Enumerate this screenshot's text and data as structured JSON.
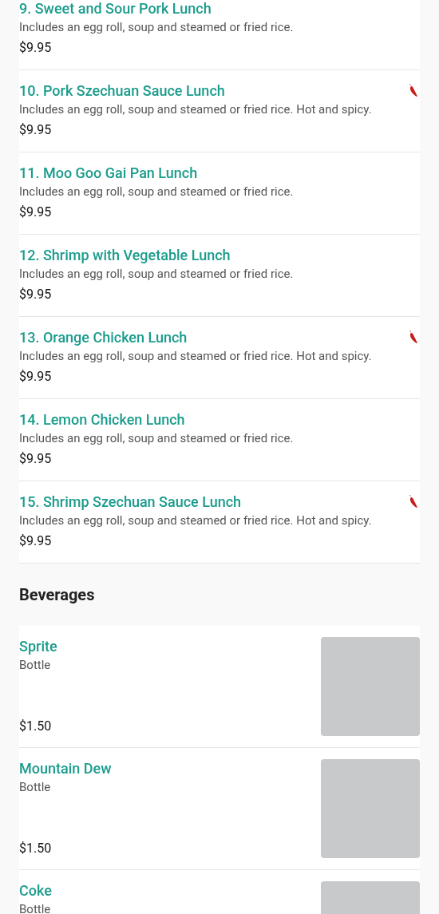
{
  "lunch_items": [
    {
      "name": "9. Sweet and Sour Pork Lunch",
      "description": "Includes an egg roll, soup and steamed or fried rice.",
      "price": "$9.95",
      "spicy": false
    },
    {
      "name": "10. Pork Szechuan Sauce Lunch",
      "description": "Includes an egg roll, soup and steamed or fried rice. Hot and spicy.",
      "price": "$9.95",
      "spicy": true
    },
    {
      "name": "11. Moo Goo Gai Pan Lunch",
      "description": "Includes an egg roll, soup and steamed or fried rice.",
      "price": "$9.95",
      "spicy": false
    },
    {
      "name": "12. Shrimp with Vegetable Lunch",
      "description": "Includes an egg roll, soup and steamed or fried rice.",
      "price": "$9.95",
      "spicy": false
    },
    {
      "name": "13. Orange Chicken Lunch",
      "description": "Includes an egg roll, soup and steamed or fried rice. Hot and spicy.",
      "price": "$9.95",
      "spicy": true
    },
    {
      "name": "14. Lemon Chicken Lunch",
      "description": "Includes an egg roll, soup and steamed or fried rice.",
      "price": "$9.95",
      "spicy": false
    },
    {
      "name": "15. Shrimp Szechuan Sauce Lunch",
      "description": "Includes an egg roll, soup and steamed or fried rice. Hot and spicy.",
      "price": "$9.95",
      "spicy": true
    }
  ],
  "beverages": {
    "heading": "Beverages",
    "items": [
      {
        "name": "Sprite",
        "description": "Bottle",
        "price": "$1.50"
      },
      {
        "name": "Mountain Dew",
        "description": "Bottle",
        "price": "$1.50"
      },
      {
        "name": "Coke",
        "description": "Bottle"
      }
    ]
  }
}
